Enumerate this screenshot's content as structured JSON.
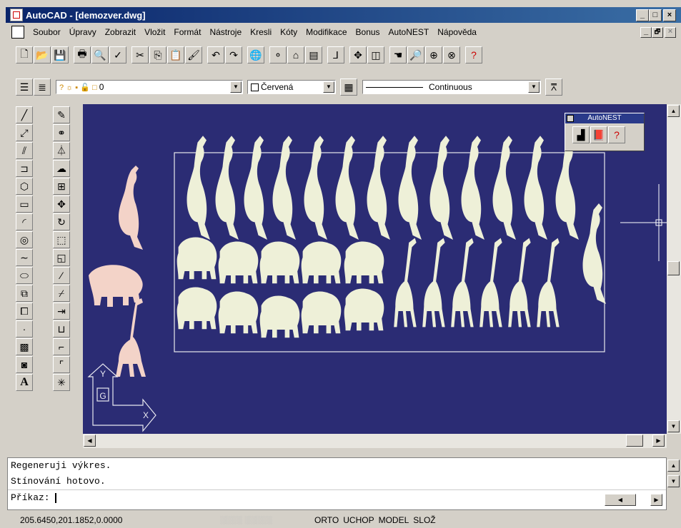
{
  "window": {
    "title": "AutoCAD - [demozver.dwg]",
    "min": "_",
    "max": "□",
    "close": "×",
    "doc_min": "_",
    "doc_restore": "🗗",
    "doc_close": "×"
  },
  "menu": [
    "Soubor",
    "Úpravy",
    "Zobrazit",
    "Vložit",
    "Formát",
    "Nástroje",
    "Kresli",
    "Kóty",
    "Modifikace",
    "Bonus",
    "AutoNEST",
    "Nápověda"
  ],
  "properties": {
    "layer": "0",
    "color": "Červená",
    "linetype": "Continuous"
  },
  "autonest_panel": {
    "title": "AutoNEST"
  },
  "command_window": {
    "lines": [
      "Regeneruji výkres.",
      "Stínování hotovo."
    ],
    "prompt": "Příkaz:"
  },
  "status": {
    "coords": "205.6450,201.1852,0.0000",
    "modes": [
      "ORTO",
      "UCHOP",
      "MODEL",
      "SLOŽ"
    ]
  },
  "ucs_icon": {
    "x": "X",
    "y": "Y",
    "g": "G"
  }
}
